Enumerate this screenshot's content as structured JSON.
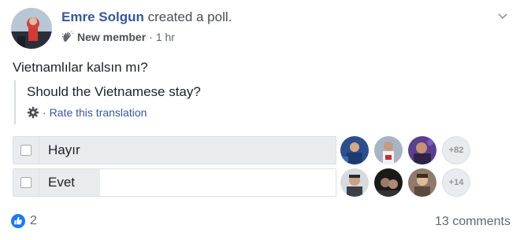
{
  "post": {
    "author_name": "Emre Solgun",
    "action": " created a poll.",
    "badge": "New member",
    "separator": "·",
    "time": "1 hr",
    "text": "Vietnamlılar kalsın mı?"
  },
  "translation": {
    "text": "Should the Vietnamese stay?",
    "separator": "·",
    "link": "Rate this translation"
  },
  "poll": {
    "options": [
      {
        "label": "Hayır",
        "more_voters": "+82",
        "share": 1.0
      },
      {
        "label": "Evet",
        "more_voters": "+14",
        "share": 0.27
      }
    ]
  },
  "footer": {
    "likes": "2",
    "comments": "13 comments"
  },
  "colors": {
    "link": "#365899",
    "like_blue": "#2078f4",
    "poll_fill": "#e9ebee"
  },
  "icons": {
    "chevron": "chevron-down-icon",
    "badge": "waving-hand-icon",
    "translation": "gear-icon",
    "like": "thumbs-up-icon"
  }
}
